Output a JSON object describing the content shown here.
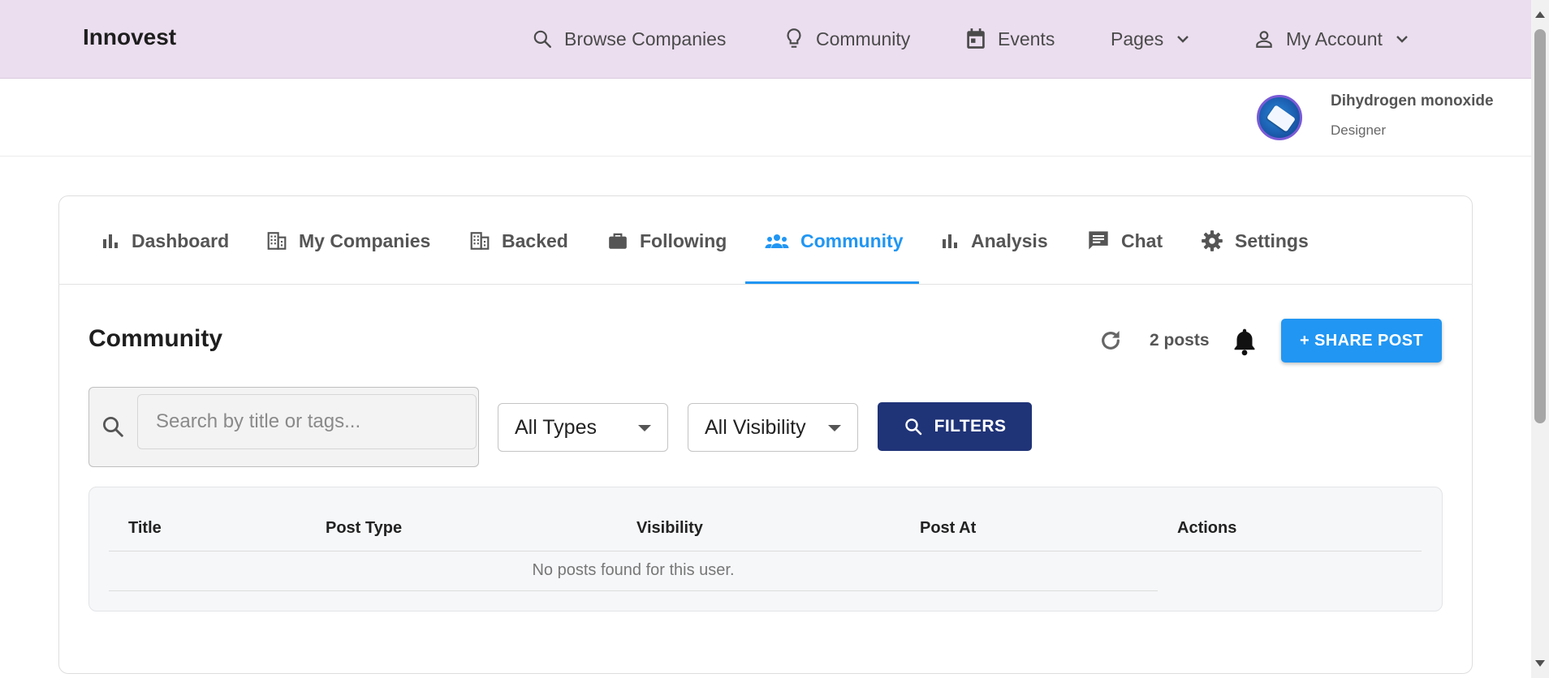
{
  "brand": "Innovest",
  "nav": {
    "items": [
      {
        "label": "Browse Companies",
        "icon": "search-icon"
      },
      {
        "label": "Community",
        "icon": "lightbulb-icon"
      },
      {
        "label": "Events",
        "icon": "calendar-icon"
      },
      {
        "label": "Pages",
        "icon": "chevron-down-icon"
      },
      {
        "label": "My Account",
        "icon": "person-icon"
      }
    ]
  },
  "user": {
    "name": "Dihydrogen monoxide",
    "role": "Designer"
  },
  "tabs": [
    {
      "label": "Dashboard",
      "icon": "bar-chart-icon"
    },
    {
      "label": "My Companies",
      "icon": "building-icon"
    },
    {
      "label": "Backed",
      "icon": "building-icon"
    },
    {
      "label": "Following",
      "icon": "briefcase-icon"
    },
    {
      "label": "Community",
      "icon": "people-icon",
      "active": true
    },
    {
      "label": "Analysis",
      "icon": "bar-chart-icon"
    },
    {
      "label": "Chat",
      "icon": "chat-icon"
    },
    {
      "label": "Settings",
      "icon": "gear-icon"
    }
  ],
  "section": {
    "title": "Community",
    "post_count": "2 posts",
    "share_label": "+ SHARE POST"
  },
  "filters": {
    "search_placeholder": "Search by title or tags...",
    "type_selected": "All Types",
    "visibility_selected": "All Visibility",
    "filters_label": "FILTERS"
  },
  "table": {
    "columns": [
      "Title",
      "Post Type",
      "Visibility",
      "Post At",
      "Actions"
    ],
    "empty_message": "No posts found for this user."
  },
  "colors": {
    "topbar": "#ebdeef",
    "accent": "#2196f3",
    "filters_button": "#1f3377"
  }
}
